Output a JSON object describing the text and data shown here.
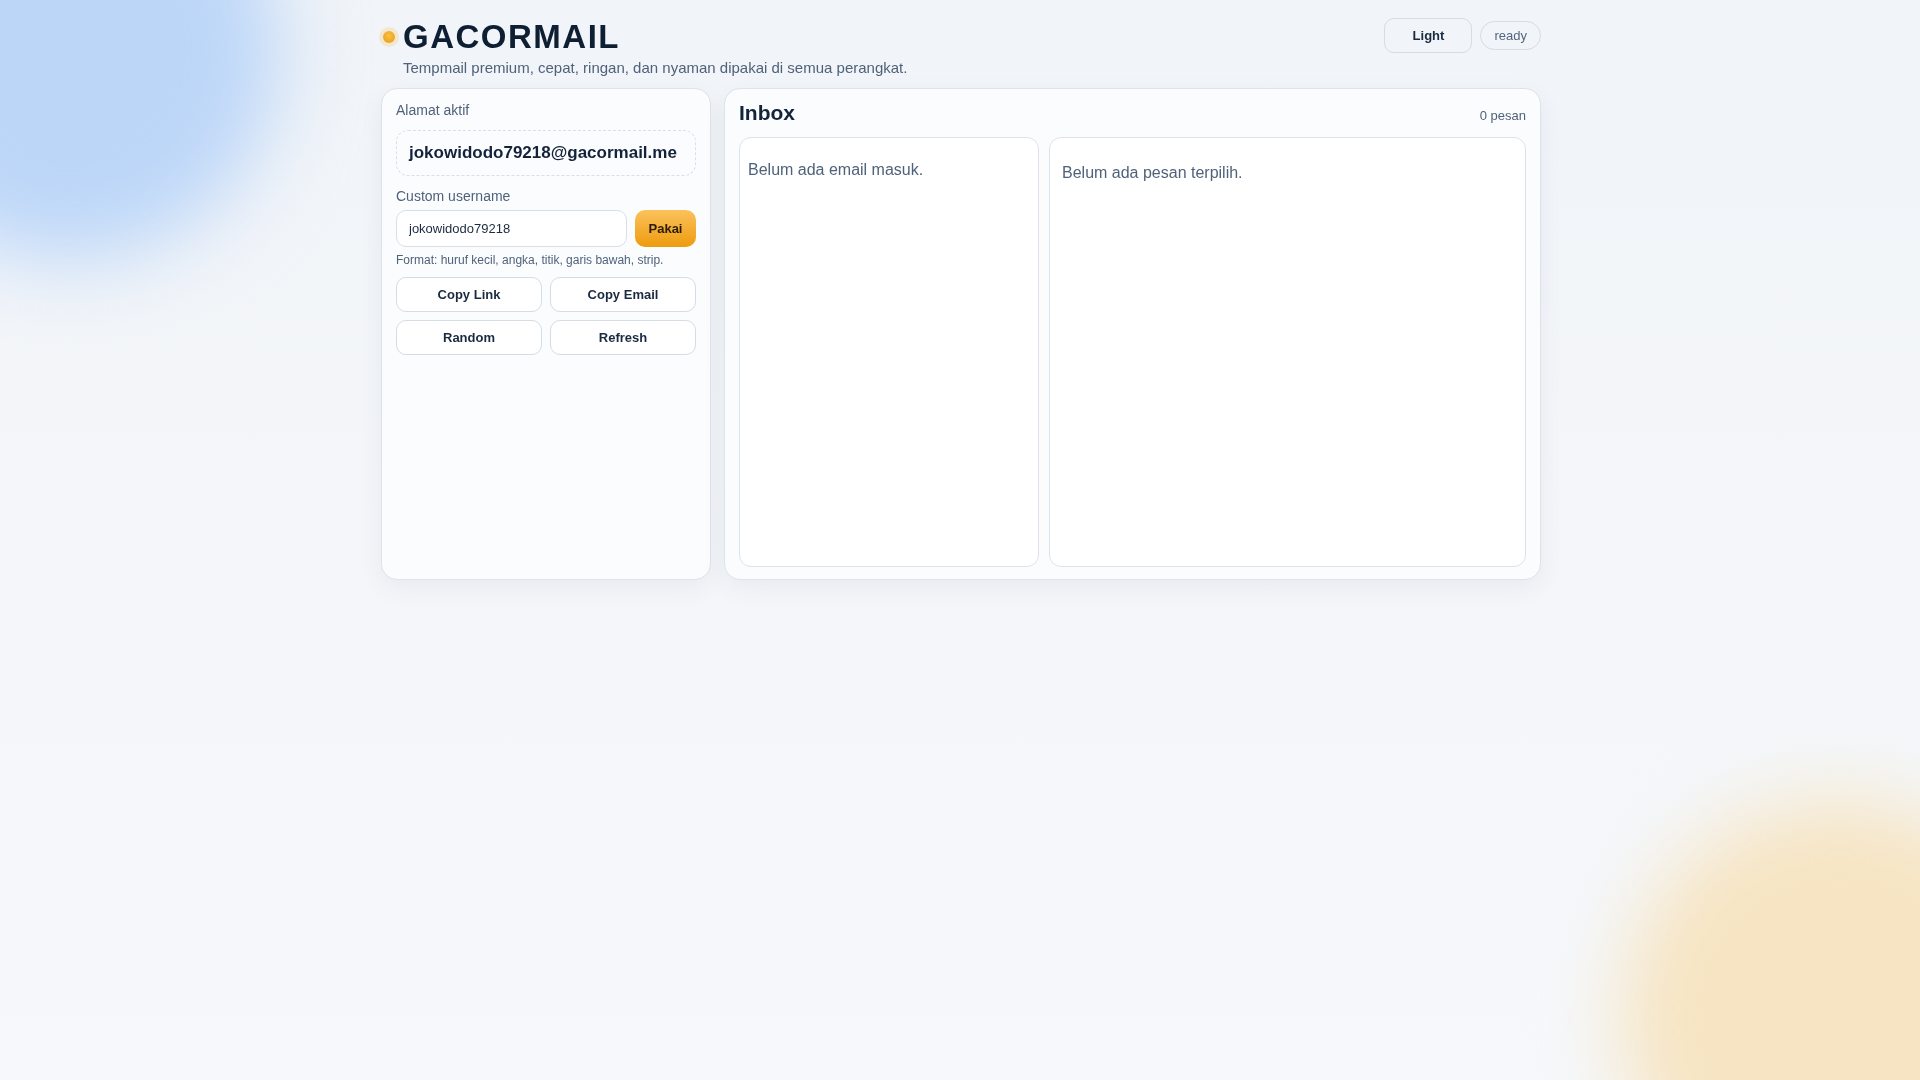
{
  "brand": {
    "title": "GACORMAIL",
    "tagline": "Tempmail premium, cepat, ringan, dan nyaman dipakai di semua perangkat."
  },
  "theme_button": "Light",
  "status": "ready",
  "address_panel": {
    "label": "Alamat aktif",
    "address": "jokowidodo79218@gacormail.me",
    "username_label": "Custom username",
    "username_value": "jokowidodo79218",
    "apply_button": "Pakai",
    "hint": "Format: huruf kecil, angka, titik, garis bawah, strip.",
    "actions": [
      "Copy Link",
      "Copy Email",
      "Random",
      "Refresh"
    ]
  },
  "inbox": {
    "title": "Inbox",
    "count": "0 pesan",
    "list_empty": "Belum ada email masuk.",
    "detail_empty": "Belum ada pesan terpilih."
  }
}
